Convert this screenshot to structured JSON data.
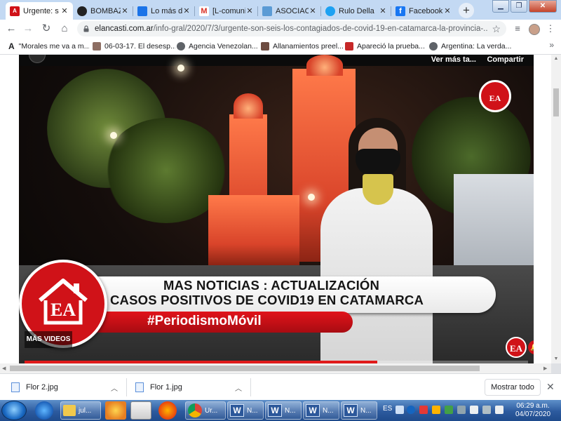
{
  "browser": {
    "tabs": [
      {
        "title": "Urgente: s",
        "favicon_text": "A",
        "favicon_color": "#d01218",
        "active": true
      },
      {
        "title": "BOMBAZO",
        "favicon_text": "",
        "favicon_color": "#222222",
        "active": false
      },
      {
        "title": "Lo más de",
        "favicon_text": "",
        "favicon_color": "#1a73e8",
        "active": false
      },
      {
        "title": "[L-comuni",
        "favicon_text": "M",
        "favicon_color": "#ffffff",
        "active": false
      },
      {
        "title": "ASOCIACI",
        "favicon_text": "",
        "favicon_color": "#5b9bd5",
        "active": false
      },
      {
        "title": "Rulo Della",
        "favicon_text": "",
        "favicon_color": "#1da1f2",
        "active": false
      },
      {
        "title": "Facebook",
        "favicon_text": "f",
        "favicon_color": "#1877f2",
        "active": false
      }
    ],
    "new_tab_label": "+",
    "address": {
      "host": "elancasti.com.ar",
      "path": "/info-gral/2020/7/3/urgente-son-seis-los-contagiados-de-covid-19-en-catamarca-la-provincia-..."
    },
    "bookmarks": [
      {
        "label": "\"Morales me va a m...",
        "icon_color": "#222222"
      },
      {
        "label": "06-03-17. El desesp...",
        "icon_color": "#8d6e63"
      },
      {
        "label": "Agencia Venezolan...",
        "icon_color": "#5f6368"
      },
      {
        "label": "Allanamientos preel...",
        "icon_color": "#6d4c41"
      },
      {
        "label": "Apareció la prueba...",
        "icon_color": "#c62828"
      },
      {
        "label": "Argentina: La verda...",
        "icon_color": "#5f6368"
      }
    ],
    "bookmarks_more": "»"
  },
  "video": {
    "top_more": "Ver más ta...",
    "top_share": "Compartir",
    "lower_third_line1": "MAS NOTICIAS : ACTUALIZACIÓN",
    "lower_third_line2": "CASOS POSITIVOS DE  COVID19 EN CATAMARCA",
    "hashtag": "#PeriodismoMóvil",
    "logo_text": "EA",
    "mas_videos": "MÁS VIDEOS",
    "progress_fraction": 0.7
  },
  "downloads": {
    "items": [
      {
        "name": "Flor 2.jpg"
      },
      {
        "name": "Flor 1.jpg"
      }
    ],
    "show_all": "Mostrar todo",
    "close": "✕"
  },
  "taskbar": {
    "windows": [
      {
        "label": "jul..."
      },
      {
        "label": "Ur..."
      },
      {
        "label": "N..."
      },
      {
        "label": "N..."
      },
      {
        "label": "N..."
      },
      {
        "label": "N..."
      }
    ],
    "language": "ES",
    "time": "06:29 a.m.",
    "date": "04/07/2020"
  }
}
